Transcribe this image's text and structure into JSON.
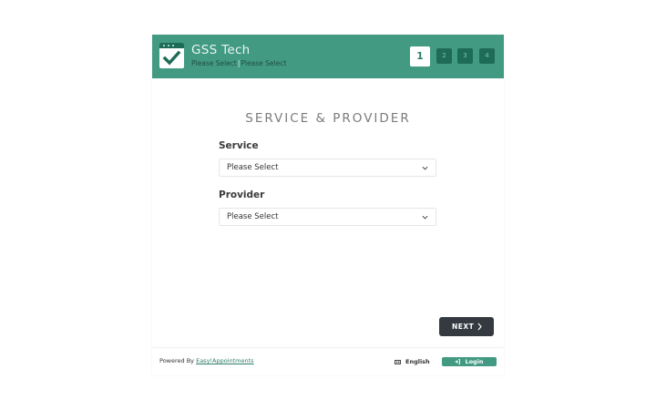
{
  "header": {
    "company_name": "GSS Tech",
    "selected_service": "Please Select",
    "separator": "|",
    "selected_provider": "Please Select",
    "steps": [
      "1",
      "2",
      "3",
      "4"
    ],
    "active_step": 1
  },
  "main": {
    "title": "SERVICE & PROVIDER",
    "service_label": "Service",
    "service_value": "Please Select",
    "provider_label": "Provider",
    "provider_value": "Please Select",
    "next_label": "NEXT"
  },
  "footer": {
    "powered_by": "Powered By",
    "powered_link": "Easy!Appointments",
    "language": "English",
    "login_label": "Login"
  },
  "colors": {
    "brand": "#429a82",
    "brand_dark": "#1e6b57",
    "button_dark": "#343a40"
  },
  "icons": {
    "logo": "checkmark-calendar-icon",
    "select_arrow": "chevron-down-icon",
    "next_arrow": "chevron-right-icon",
    "language": "language-icon",
    "login": "sign-in-icon"
  }
}
